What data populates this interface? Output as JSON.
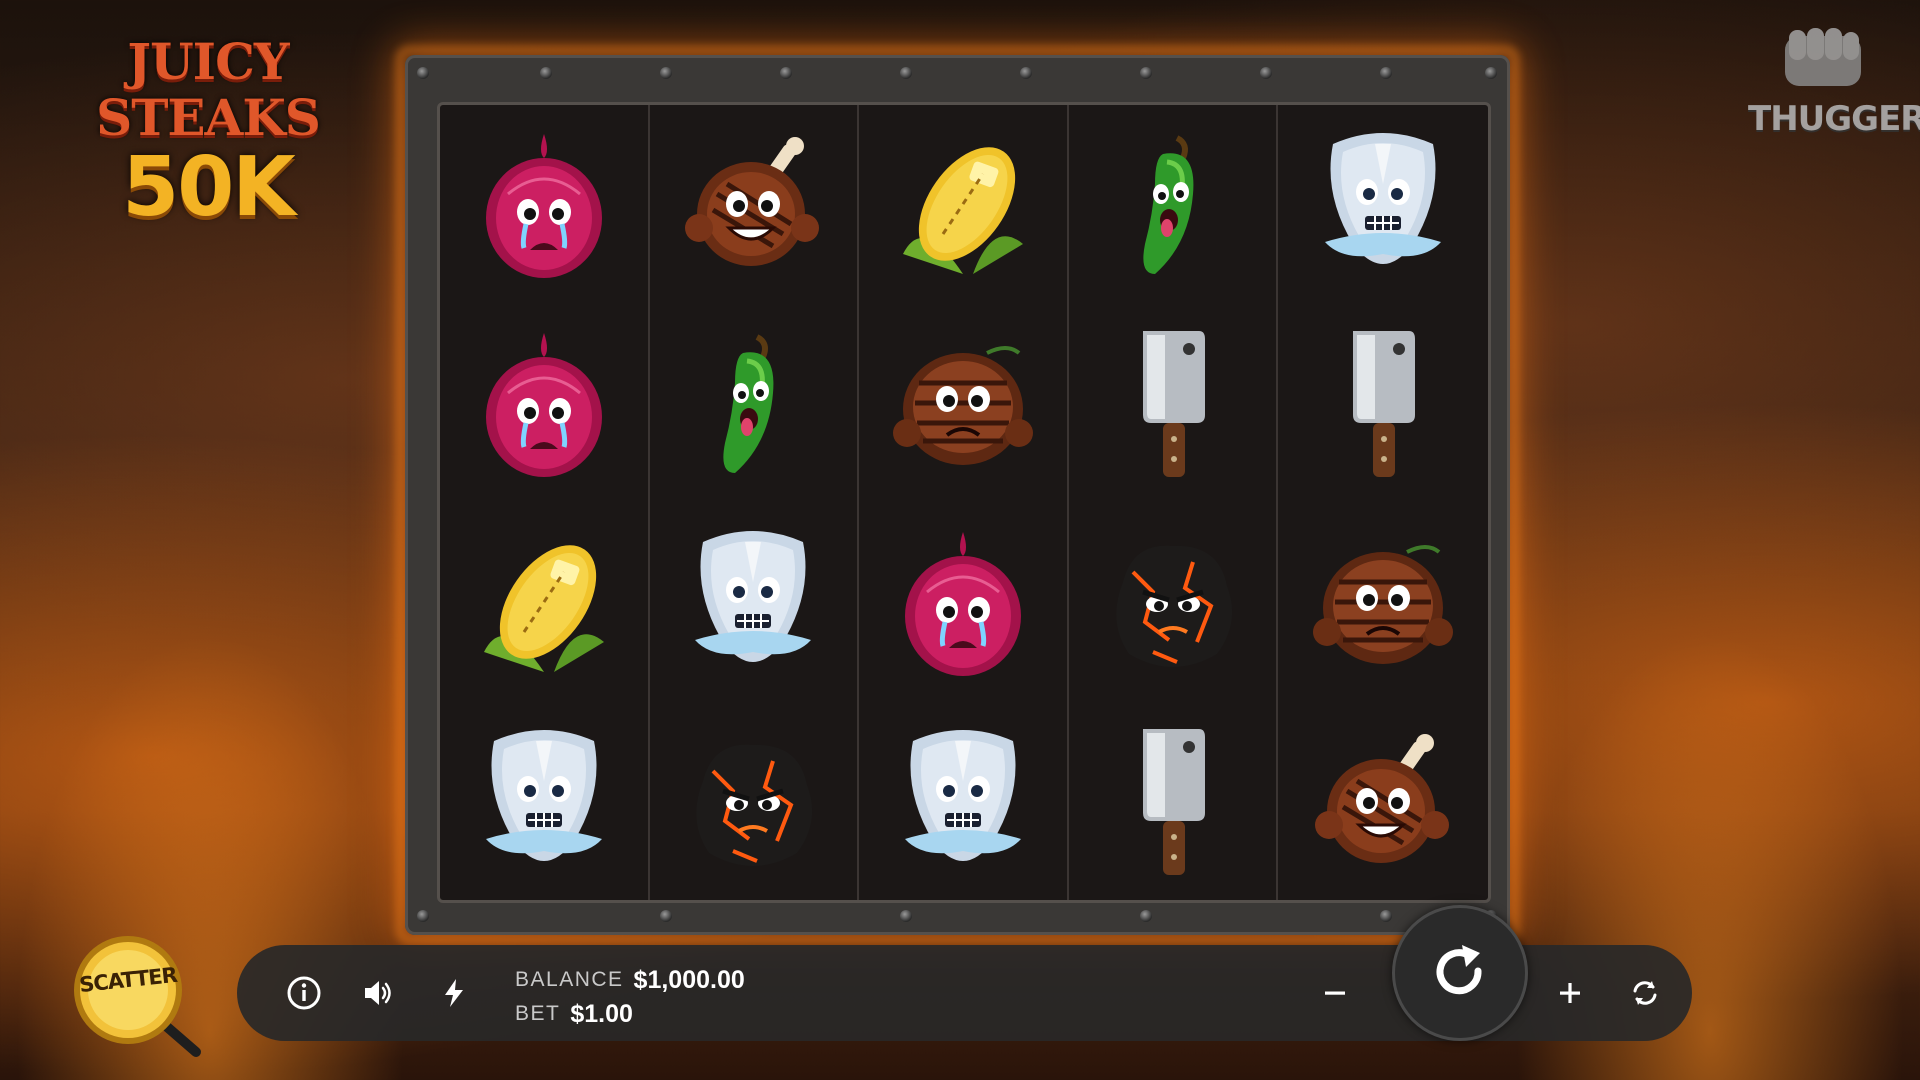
{
  "game": {
    "logo_line1": "JUICY STEAKS",
    "logo_line2": "50K",
    "brand": "THUGGER"
  },
  "reels": [
    [
      "red-onion-crying",
      "red-onion-crying",
      "corn-cob",
      "frozen-steak"
    ],
    [
      "tbone-steak-grinning",
      "jalapeno-pepper",
      "frozen-steak",
      "lava-coal"
    ],
    [
      "corn-cob",
      "grilled-steak-worried",
      "red-onion-crying",
      "frozen-steak"
    ],
    [
      "jalapeno-pepper",
      "meat-cleaver",
      "lava-coal",
      "meat-cleaver"
    ],
    [
      "frozen-steak",
      "meat-cleaver",
      "grilled-steak-worried",
      "tbone-steak-grinning"
    ]
  ],
  "controls": {
    "balance_label": "BALANCE",
    "balance_value": "$1,000.00",
    "bet_label": "BET",
    "bet_value": "$1.00",
    "scatter_label": "SCATTER",
    "info_icon": "info-icon",
    "sound_icon": "speaker-icon",
    "turbo_icon": "lightning-icon",
    "minus_icon": "minus-icon",
    "spin_icon": "spin-arrow-icon",
    "plus_icon": "plus-icon",
    "autoplay_icon": "autoplay-icon"
  },
  "colors": {
    "bar_bg": "#282828",
    "reel_bg": "#1b1716",
    "accent_gold": "#f3b324",
    "logo_red": "#e0572a"
  }
}
